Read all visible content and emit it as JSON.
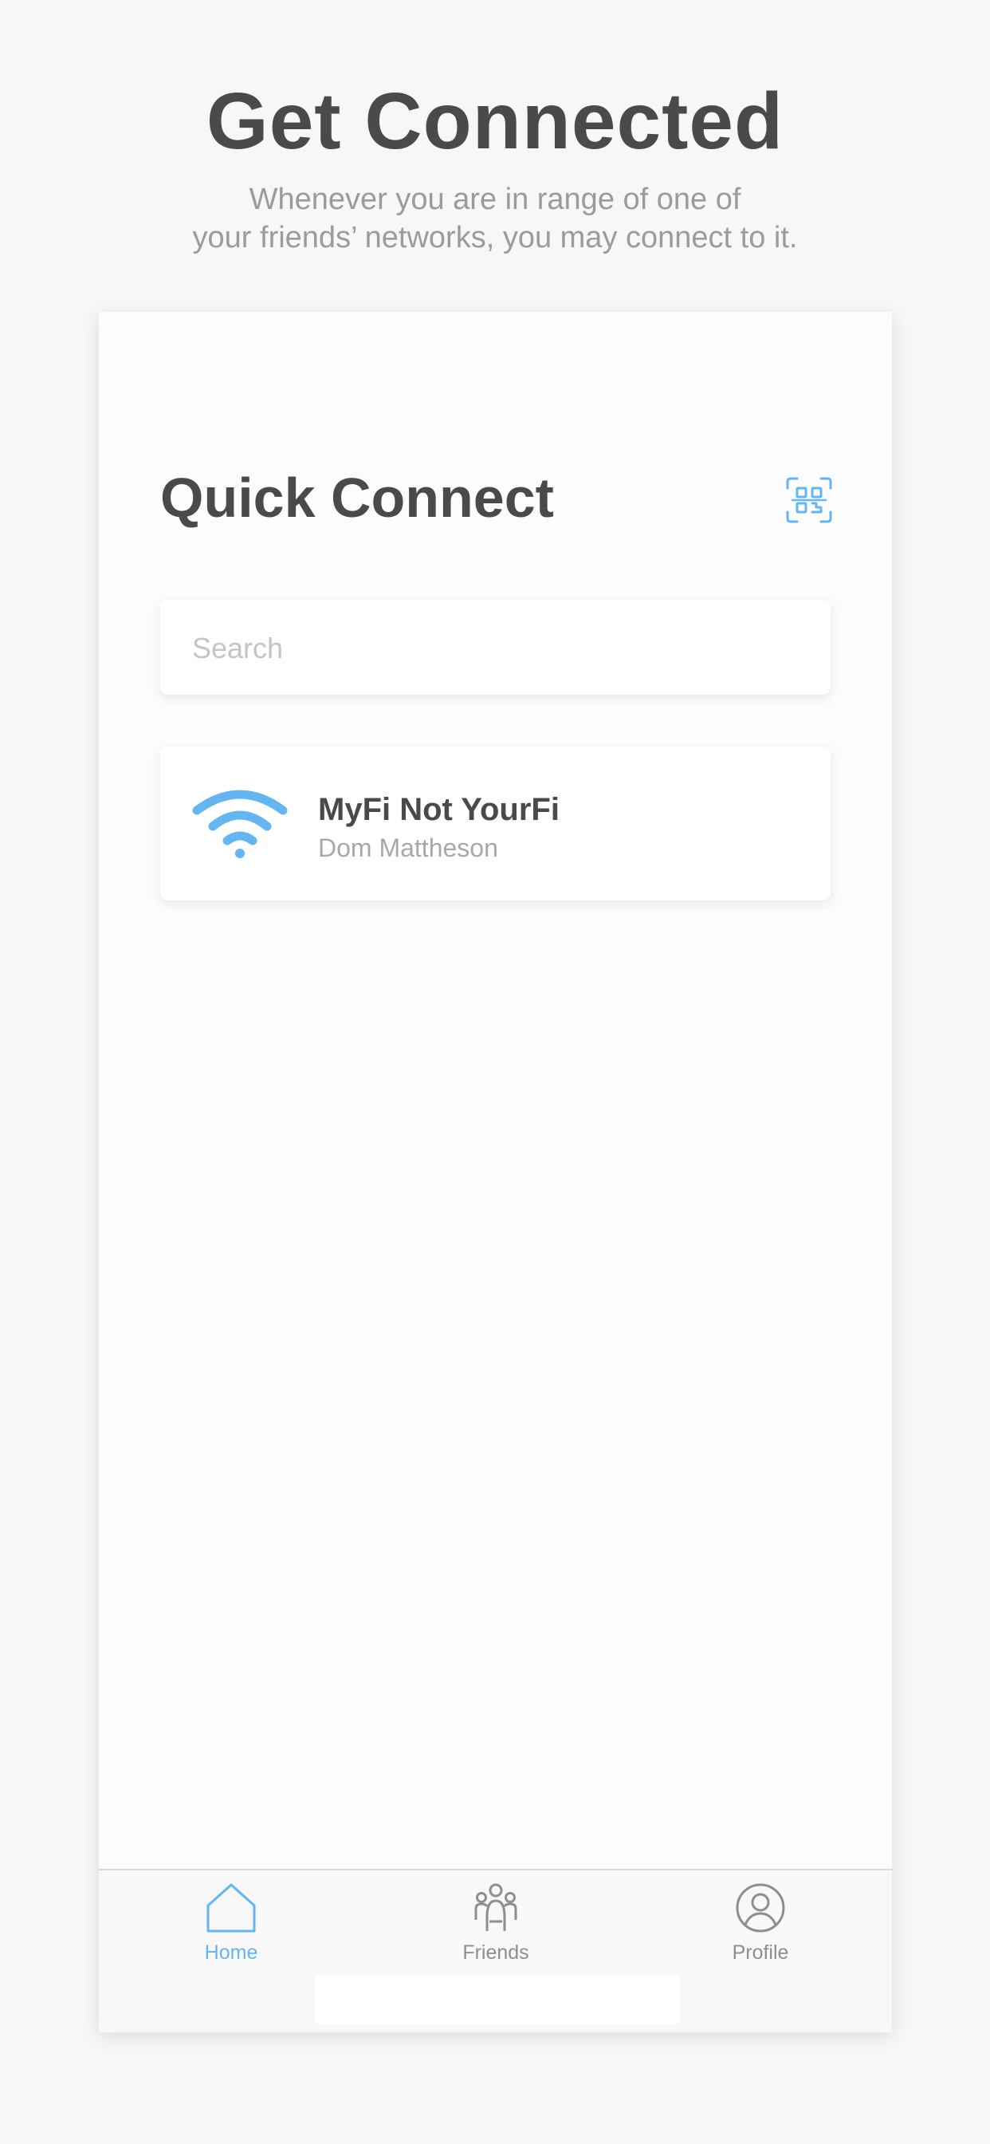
{
  "header": {
    "title": "Get Connected",
    "subtitle_line1": "Whenever you are in range of one of",
    "subtitle_line2": "your friends’ networks, you may connect to it."
  },
  "quick_connect": {
    "title": "Quick Connect",
    "qr_icon": "qr-code-scan-icon"
  },
  "search": {
    "placeholder": "Search",
    "value": ""
  },
  "networks": [
    {
      "name": "MyFi Not YourFi",
      "owner": "Dom Mattheson",
      "icon": "wifi-icon"
    }
  ],
  "tabs": [
    {
      "label": "Home",
      "icon": "home-icon",
      "active": true
    },
    {
      "label": "Friends",
      "icon": "friends-icon",
      "active": false
    },
    {
      "label": "Profile",
      "icon": "profile-icon",
      "active": false
    }
  ],
  "colors": {
    "accent": "#64b5f0",
    "text_dark": "#4a4a4a",
    "text_muted": "#9b9b9b",
    "background": "#f6f7f9"
  }
}
